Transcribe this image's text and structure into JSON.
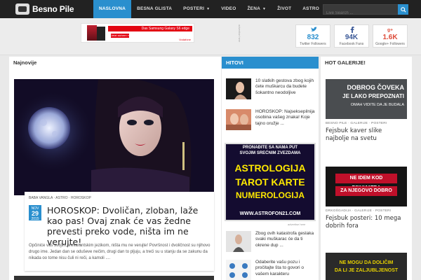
{
  "logo": {
    "text": "Besno Pile"
  },
  "nav": {
    "items": [
      {
        "label": "NASLOVNA",
        "active": true,
        "dropdown": false
      },
      {
        "label": "BESNA GLISTA",
        "active": false,
        "dropdown": false
      },
      {
        "label": "POSTERI",
        "active": false,
        "dropdown": true
      },
      {
        "label": "VIDEO",
        "active": false,
        "dropdown": false
      },
      {
        "label": "ŽENA",
        "active": false,
        "dropdown": true
      },
      {
        "label": "ŽIVOT",
        "active": false,
        "dropdown": false
      },
      {
        "label": "ASTRO",
        "active": false,
        "dropdown": false
      }
    ]
  },
  "search": {
    "placeholder": "Live Search ..."
  },
  "banner": {
    "headline": "Das Samsung Galaxy S6 edge",
    "button": "Jetzt sichern »",
    "brand": "Vodafone"
  },
  "ad_label": "advertise here",
  "social": [
    {
      "icon": "twitter-icon",
      "count": "832",
      "label": "Twitter Followers",
      "color": "#2a8fce"
    },
    {
      "icon": "facebook-icon",
      "count": "94K",
      "label": "Facebook Fans",
      "color": "#3b5998"
    },
    {
      "icon": "googleplus-icon",
      "count": "1.6K",
      "label": "Google+ Followers",
      "color": "#dd4b39"
    }
  ],
  "sections": {
    "latest": "Najnovije",
    "hits": "HITOVI",
    "gallery": "HOT GALERIJE!"
  },
  "hero": {
    "meta": "BABA VANGLA · ASTRO · HOROSKOP",
    "date_month": "NOV",
    "date_day": "29",
    "date_year": "2015",
    "title": "HOROSKOP: Dvoličan, zloban, laže kao pas! Ovaj znak će vas žedne prevesti preko vode, ništa im ne verujte!",
    "excerpt": "Opčiniće vas svojim prevarantskim jezikom, ništa mu ne verujte! Površnost i dvoličnost su njihovo drugo ime. Jedan dan se oduševe nečim, drugi dan to pljuju, a treći su u stanju da se zakunu da nikada oo tome nisu čuli ni reči, a kamoli ...."
  },
  "hits": [
    {
      "title": "10 slatkih gestova zbog kojih ćete muškarcu da budete šokantno neodoljive"
    },
    {
      "title": "HOROSKOP: Najseksepilnija osobina vašeg znaka! Koje tajno oružje ..."
    },
    {
      "title": "Zbog ovih katastrofa geslaka svaki muškarac će da ti okrene dup ..."
    },
    {
      "title": "Odaberite vašu pozu i pročitajte šta to govori o vašem karakteru"
    }
  ],
  "astro_ad": {
    "top": "PRONAĐITE SA NAMA PUT",
    "top2": "SVOJIM SREĆNIM ZVEZDAMA",
    "line1": "ASTROLOGIJA",
    "line2": "TAROT KARTE",
    "line3": "NUMEROLOGIJA",
    "url": "WWW.ASTROFON21.COM",
    "note": "advertise here"
  },
  "gallery": [
    {
      "img_text1": "DOBROG ČOVEKA",
      "img_text2": "JE LAKO PREPOZNATI",
      "img_text3": "OMAH VIDITE DA JE BUDALA",
      "meta": "BESNO PILE · GALERIJE · POSTERI",
      "title": "Fejsbuk kaver slike najbolje na svetu"
    },
    {
      "img_text1": "NE IDEM KOD PSIHIJATRA",
      "img_text2": "ZA NJEGOVO DOBRO",
      "img_text3": "",
      "meta": "DRKOŠGADIJA · GALERIJE · POSTERI",
      "title": "Fejsbuk posteri: 10 mega dobrih fora"
    },
    {
      "img_text1": "NE MOGU DA DOLIČIM",
      "img_text2": "DA LI JE ZALJUBLJENOST",
      "img_text3": "",
      "meta": "",
      "title": ""
    }
  ]
}
